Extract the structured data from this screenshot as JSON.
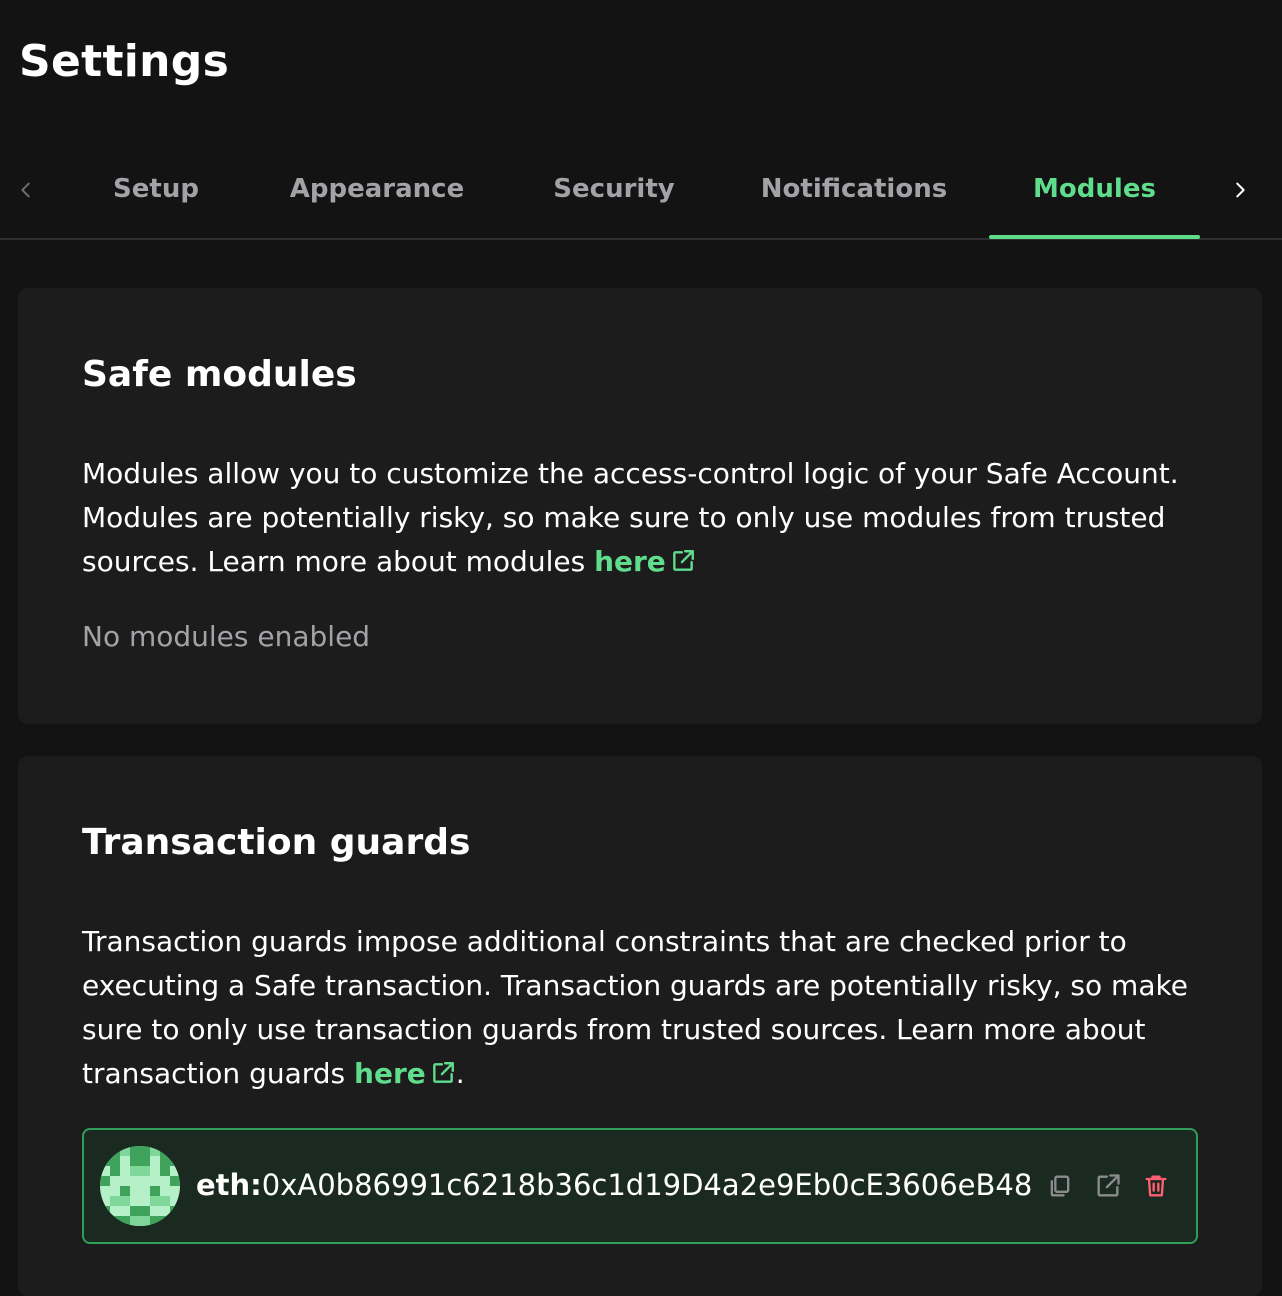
{
  "page": {
    "title": "Settings"
  },
  "tabs": [
    {
      "label": "Setup"
    },
    {
      "label": "Appearance"
    },
    {
      "label": "Security"
    },
    {
      "label": "Notifications"
    },
    {
      "label": "Modules",
      "active": true
    }
  ],
  "safe_modules": {
    "title": "Safe modules",
    "description": "Modules allow you to customize the access-control logic of your Safe Account. Modules are potentially risky, so make sure to only use modules from trusted sources. Learn more about modules ",
    "link_label": "here",
    "empty_state": "No modules enabled"
  },
  "transaction_guards": {
    "title": "Transaction guards",
    "description": "Transaction guards impose additional constraints that are checked prior to executing a Safe transaction. Transaction guards are potentially risky, so make sure to only use transaction guards from trusted sources. Learn more about transaction guards ",
    "link_label": "here",
    "trailing": ".",
    "guard": {
      "chain_prefix": "eth:",
      "address": "0xA0b86991c6218b36c1d19D4a2e9Eb0cE3606eB48"
    }
  },
  "colors": {
    "accent": "#5fdd8d",
    "danger": "#ff5f72",
    "background": "#121312",
    "card": "#1c1c1c"
  },
  "icons": {
    "tabs_prev": "chevron-left-icon",
    "tabs_next": "chevron-right-icon",
    "external_link": "external-link-icon",
    "copy": "copy-icon",
    "delete": "trash-icon"
  }
}
